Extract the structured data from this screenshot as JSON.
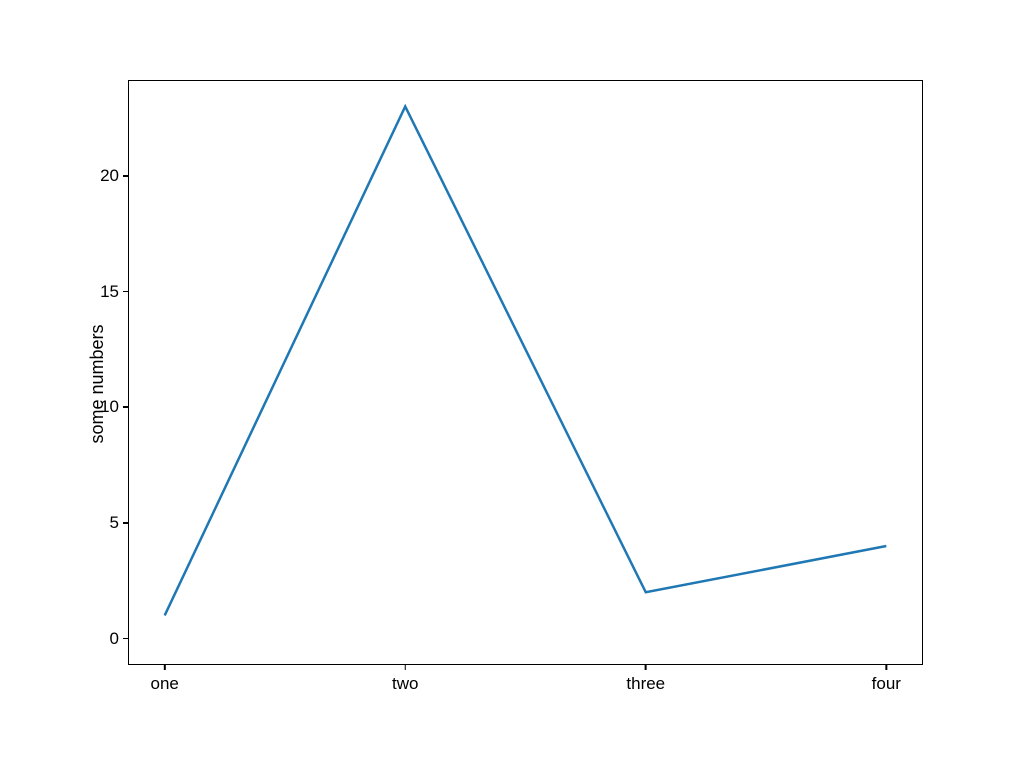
{
  "chart_data": {
    "type": "line",
    "categories": [
      "one",
      "two",
      "three",
      "four"
    ],
    "values": [
      1,
      23,
      2,
      4
    ],
    "title": "",
    "xlabel": "",
    "ylabel": "some numbers",
    "ylim": [
      -1.1,
      24.1
    ],
    "yticks": [
      0,
      5,
      10,
      15,
      20
    ]
  }
}
